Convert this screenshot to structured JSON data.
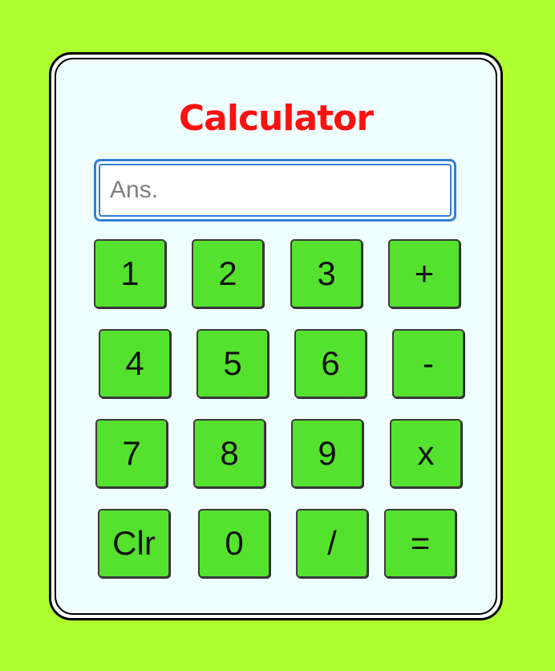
{
  "app": {
    "title": "Calculator"
  },
  "display": {
    "placeholder": "Ans.",
    "value": ""
  },
  "keys": {
    "k1": "1",
    "k2": "2",
    "k3": "3",
    "plus": "+",
    "k4": "4",
    "k5": "5",
    "k6": "6",
    "minus": "-",
    "k7": "7",
    "k8": "8",
    "k9": "9",
    "multiply": "x",
    "clear": "Clr",
    "k0": "0",
    "divide": "/",
    "equals": "="
  },
  "colors": {
    "background": "#adff2f",
    "panel": "#eefffe",
    "title": "#ff1010",
    "key": "#55e22e",
    "display_border": "#2f7fd6"
  }
}
